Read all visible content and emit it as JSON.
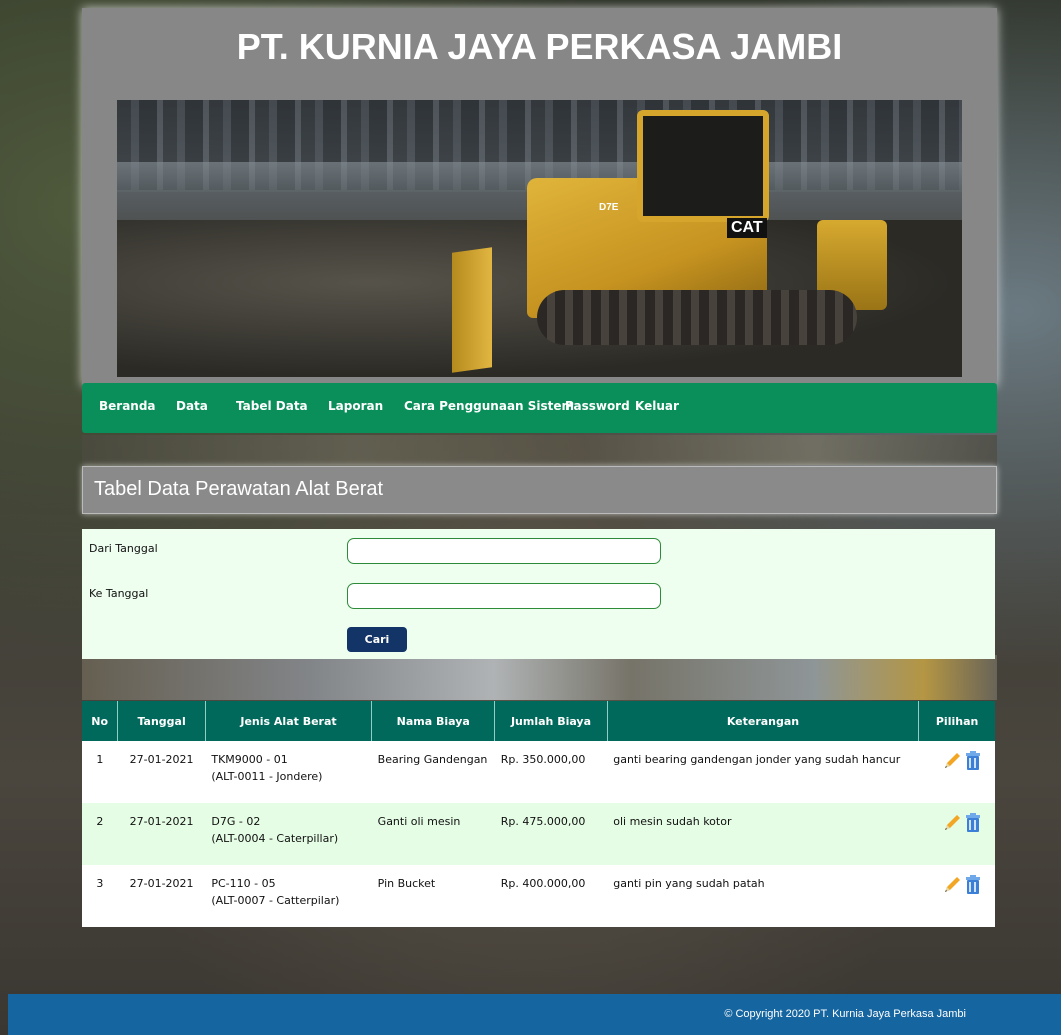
{
  "site": {
    "title": "PT. KURNIA JAYA PERKASA JAMBI",
    "banner_texts": {
      "model": "D7E",
      "brand": "CAT"
    }
  },
  "nav": {
    "items": [
      {
        "label": "Beranda"
      },
      {
        "label": "Data"
      },
      {
        "label": "Tabel Data"
      },
      {
        "label": "Laporan"
      },
      {
        "label": "Cara Penggunaan Sistem"
      },
      {
        "label": "Password"
      },
      {
        "label": "Keluar"
      }
    ]
  },
  "page": {
    "title": "Tabel Data Perawatan Alat Berat"
  },
  "filter": {
    "from_label": "Dari Tanggal",
    "from_value": "",
    "to_label": "Ke Tanggal",
    "to_value": "",
    "search_button": "Cari"
  },
  "table": {
    "headers": [
      "No",
      "Tanggal",
      "Jenis Alat Berat",
      "Nama Biaya",
      "Jumlah Biaya",
      "Keterangan",
      "Pilihan"
    ],
    "rows": [
      {
        "no": "1",
        "tanggal": "27-01-2021",
        "alat_1": "TKM9000 - 01",
        "alat_2": "(ALT-0011 - Jondere)",
        "nama_biaya": "Bearing Gandengan",
        "jumlah": "Rp. 350.000,00",
        "keterangan": "ganti bearing gandengan jonder yang sudah hancur"
      },
      {
        "no": "2",
        "tanggal": "27-01-2021",
        "alat_1": "D7G - 02",
        "alat_2": "(ALT-0004 - Caterpillar)",
        "nama_biaya": "Ganti oli mesin",
        "jumlah": "Rp. 475.000,00",
        "keterangan": "oli mesin sudah kotor"
      },
      {
        "no": "3",
        "tanggal": "27-01-2021",
        "alat_1": "PC-110 - 05",
        "alat_2": "(ALT-0007 - Catterpilar)",
        "nama_biaya": "Pin Bucket",
        "jumlah": "Rp. 400.000,00",
        "keterangan": "ganti pin yang sudah patah"
      }
    ],
    "icons": {
      "edit": "pencil-icon",
      "delete": "trash-icon"
    }
  },
  "footer": {
    "copyright": "© Copyright 2020 PT. Kurnia Jaya Perkasa Jambi"
  },
  "colors": {
    "nav_green": "#0b8f5a",
    "table_header": "#00695c",
    "footer_blue": "#1565a0",
    "button_navy": "#123466",
    "row_alt": "#e5fde5"
  }
}
